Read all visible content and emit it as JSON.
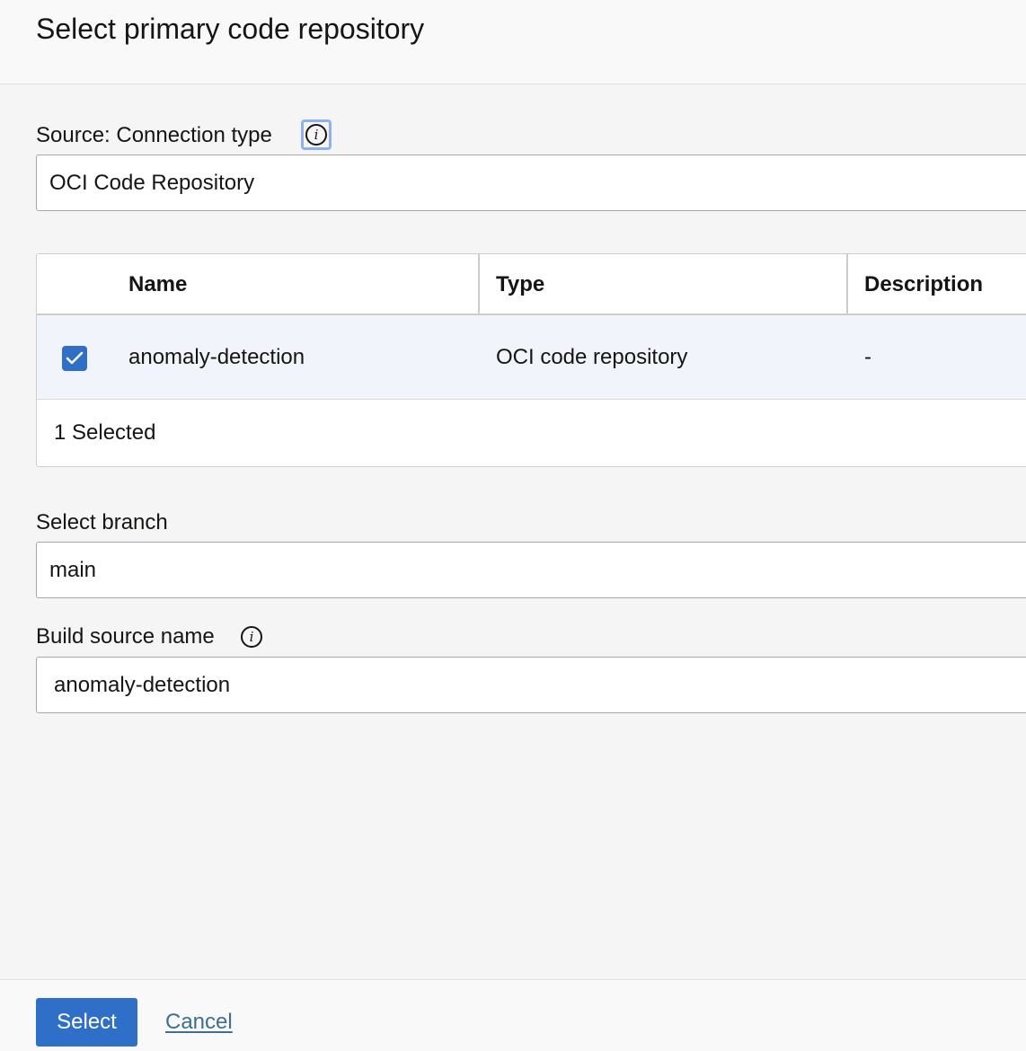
{
  "header": {
    "title": "Select primary code repository"
  },
  "connection_type": {
    "label": "Source: Connection type",
    "info_icon": "info-icon",
    "value": "OCI Code Repository"
  },
  "repo_table": {
    "columns": [
      "Name",
      "Type",
      "Description"
    ],
    "rows": [
      {
        "selected": true,
        "name": "anomaly-detection",
        "type": "OCI code repository",
        "description": "-"
      }
    ],
    "selected_count": "1 Selected"
  },
  "branch": {
    "label": "Select branch",
    "value": "main"
  },
  "build_source": {
    "label": "Build source name",
    "info_icon": "info-icon",
    "value": "anomaly-detection"
  },
  "actions": {
    "select_label": "Select",
    "cancel_label": "Cancel"
  },
  "colors": {
    "accent": "#2f6fc8",
    "link": "#3d6f90",
    "selected_row": "#f1f5fb"
  }
}
